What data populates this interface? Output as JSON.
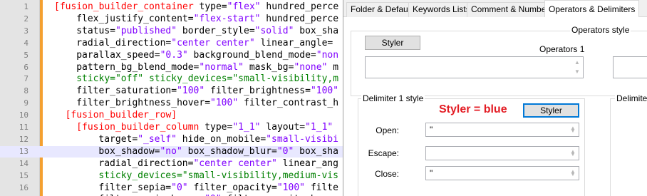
{
  "editor": {
    "lines": [
      {
        "num": "1",
        "indent": 0,
        "current": false,
        "tokens": [
          [
            "tag",
            "[fusion_builder_container "
          ],
          [
            "attr",
            "type="
          ],
          [
            "val",
            "\"flex\""
          ],
          [
            "attr",
            " hundred_perce"
          ]
        ]
      },
      {
        "num": "2",
        "indent": 4,
        "current": false,
        "tokens": [
          [
            "attr",
            "flex_justify_content="
          ],
          [
            "val",
            "\"flex-start\""
          ],
          [
            "attr",
            " hundred_perce"
          ]
        ]
      },
      {
        "num": "3",
        "indent": 4,
        "current": false,
        "tokens": [
          [
            "attr",
            "status="
          ],
          [
            "val",
            "\"published\""
          ],
          [
            "attr",
            " border_style="
          ],
          [
            "val",
            "\"solid\""
          ],
          [
            "attr",
            " box_sha"
          ]
        ]
      },
      {
        "num": "4",
        "indent": 4,
        "current": false,
        "tokens": [
          [
            "attr",
            "radial_direction="
          ],
          [
            "val",
            "\"center center\""
          ],
          [
            "attr",
            " linear_angle="
          ]
        ]
      },
      {
        "num": "5",
        "indent": 4,
        "current": false,
        "tokens": [
          [
            "attr",
            "parallax_speed="
          ],
          [
            "val",
            "\"0.3\""
          ],
          [
            "attr",
            " background_blend_mode="
          ],
          [
            "val",
            "\"non"
          ]
        ]
      },
      {
        "num": "6",
        "indent": 4,
        "current": false,
        "tokens": [
          [
            "attr",
            "pattern_bg_blend_mode="
          ],
          [
            "val",
            "\"normal\""
          ],
          [
            "attr",
            " mask_bg="
          ],
          [
            "val",
            "\"none\""
          ],
          [
            "attr",
            " m"
          ]
        ]
      },
      {
        "num": "7",
        "indent": 4,
        "current": false,
        "tokens": [
          [
            "green",
            "sticky="
          ],
          [
            "green",
            "\"off\""
          ],
          [
            "green",
            " sticky_devices="
          ],
          [
            "green",
            "\"small-visibility,m"
          ]
        ]
      },
      {
        "num": "8",
        "indent": 4,
        "current": false,
        "tokens": [
          [
            "attr",
            "filter_saturation="
          ],
          [
            "val",
            "\"100\""
          ],
          [
            "attr",
            " filter_brightness="
          ],
          [
            "val",
            "\"100\""
          ]
        ]
      },
      {
        "num": "9",
        "indent": 4,
        "current": false,
        "tokens": [
          [
            "attr",
            "filter_brightness_hover="
          ],
          [
            "val",
            "\"100\""
          ],
          [
            "attr",
            " filter_contrast_h"
          ]
        ]
      },
      {
        "num": "10",
        "indent": 2,
        "current": false,
        "tokens": [
          [
            "tag",
            "[fusion_builder_row]"
          ]
        ]
      },
      {
        "num": "11",
        "indent": 4,
        "current": false,
        "tokens": [
          [
            "tag",
            "[fusion_builder_column "
          ],
          [
            "attr",
            "type="
          ],
          [
            "val",
            "\"1_1\""
          ],
          [
            "attr",
            " layout="
          ],
          [
            "val",
            "\"1_1\""
          ]
        ]
      },
      {
        "num": "12",
        "indent": 8,
        "current": false,
        "tokens": [
          [
            "attr",
            "target="
          ],
          [
            "val",
            "\"_self\""
          ],
          [
            "attr",
            " hide_on_mobile="
          ],
          [
            "val",
            "\"small-visibi"
          ]
        ]
      },
      {
        "num": "13",
        "indent": 8,
        "current": true,
        "tokens": [
          [
            "attr",
            "box_shadow="
          ],
          [
            "val",
            "\"no\""
          ],
          [
            "attr",
            " box_shadow_blur="
          ],
          [
            "val",
            "\"0\""
          ],
          [
            "attr",
            " box_sha"
          ]
        ]
      },
      {
        "num": "14",
        "indent": 8,
        "current": false,
        "tokens": [
          [
            "attr",
            "radial_direction="
          ],
          [
            "val",
            "\"center center\""
          ],
          [
            "attr",
            " linear_ang"
          ]
        ]
      },
      {
        "num": "15",
        "indent": 8,
        "current": false,
        "tokens": [
          [
            "green",
            "sticky_devices="
          ],
          [
            "green",
            "\"small-visibility,medium-vis"
          ]
        ]
      },
      {
        "num": "16",
        "indent": 8,
        "current": false,
        "tokens": [
          [
            "attr",
            "filter_sepia="
          ],
          [
            "val",
            "\"0\""
          ],
          [
            "attr",
            " filter_opacity="
          ],
          [
            "val",
            "\"100\""
          ],
          [
            "attr",
            " filte"
          ]
        ]
      },
      {
        "num": "17",
        "indent": 8,
        "current": false,
        "tokens": [
          [
            "attr",
            "filter_sepia_hover="
          ],
          [
            "val",
            "\"0\""
          ],
          [
            "attr",
            " filter_opacity_hover"
          ]
        ]
      }
    ]
  },
  "dialog": {
    "tabs": [
      {
        "label": "Folder & Default",
        "active": false
      },
      {
        "label": "Keywords Lists",
        "active": false
      },
      {
        "label": "Comment & Number",
        "active": false
      },
      {
        "label": "Operators & Delimiters",
        "active": true
      }
    ],
    "operators_style_label": "Operators style",
    "operators_styler_button": "Styler",
    "operators1_label": "Operators 1",
    "delimiter1_style_label": "Delimiter 1 style",
    "delimiter_right_label": "Delimiter",
    "annotation": "Styler = blue",
    "annotation_color": "#e31b23",
    "delimiter1_styler_button": "Styler",
    "open_label": "Open:",
    "open_value": "\"",
    "escape_label": "Escape:",
    "escape_value": "",
    "close_label": "Close:",
    "close_value": "\""
  }
}
